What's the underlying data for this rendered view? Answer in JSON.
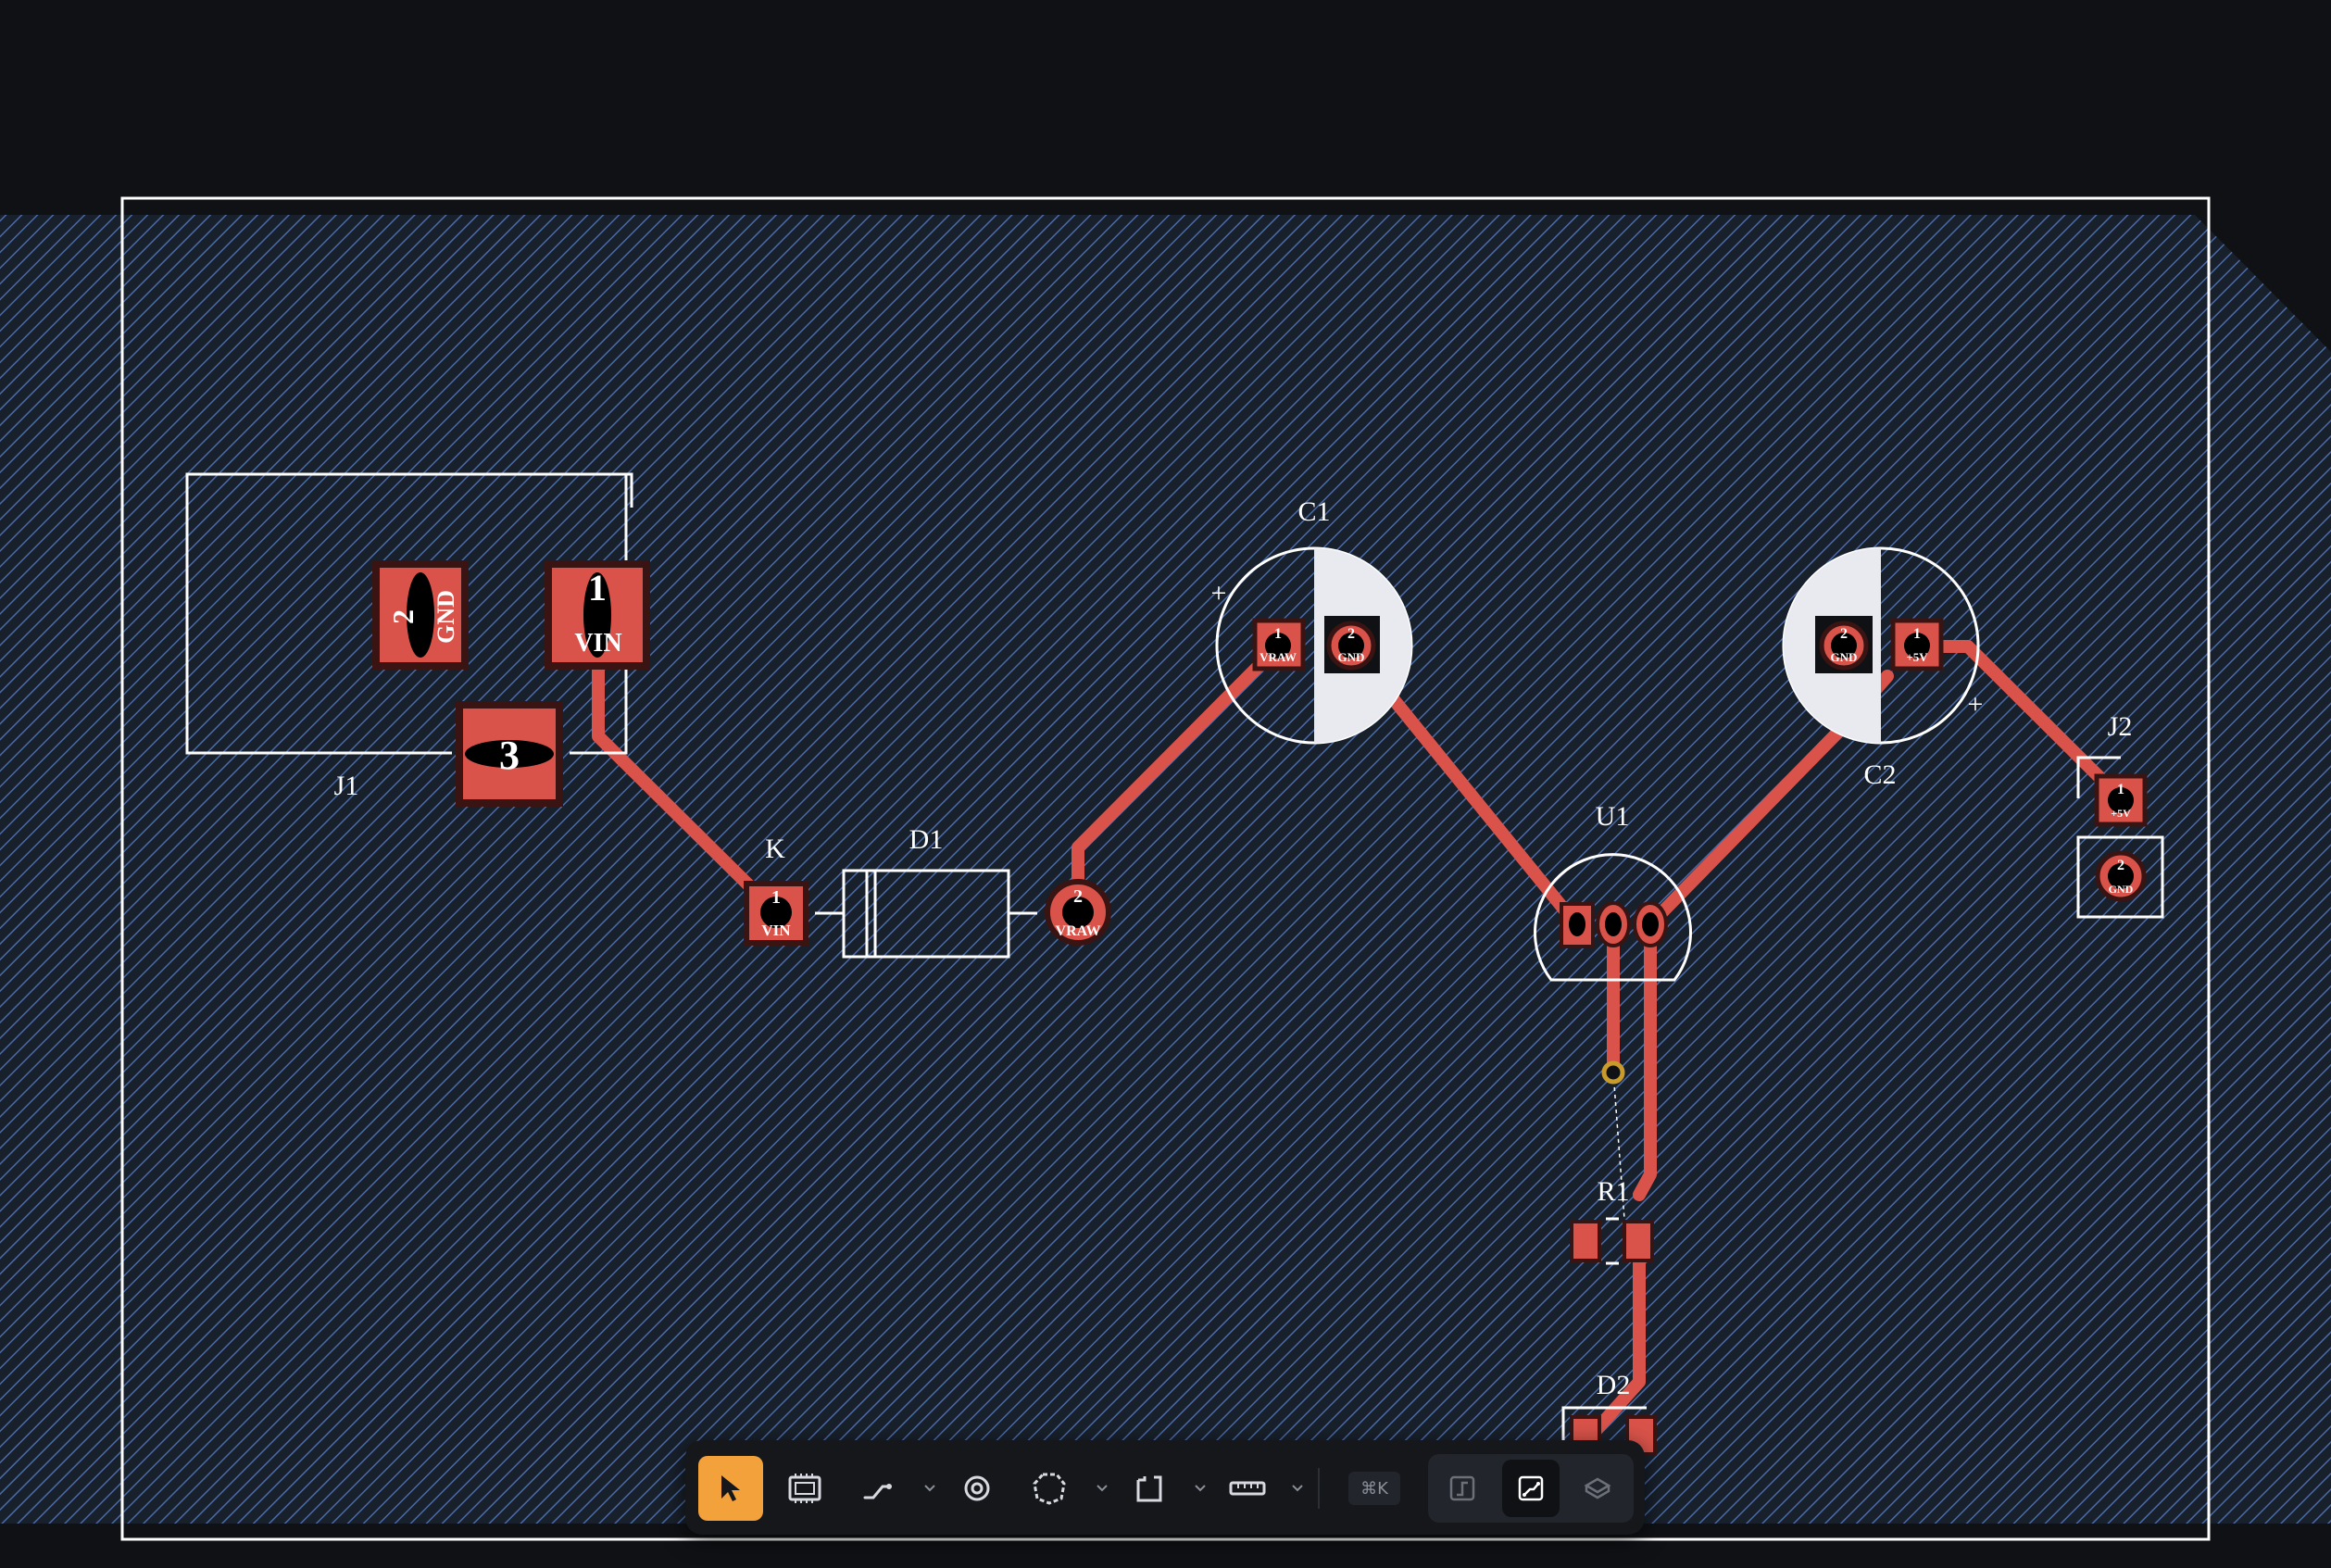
{
  "colors": {
    "background": "#0f1114",
    "board": "#18202b",
    "hatch": "#4a6aa8",
    "copper": "#d9534a",
    "silkscreen": "#ffffff",
    "via": "#c89b2a",
    "toolbar_bg": "#15171b",
    "toolbar_active": "#f2a13b"
  },
  "components": {
    "j1": {
      "ref": "J1",
      "pads": [
        {
          "num": "2",
          "net": "GND"
        },
        {
          "num": "1",
          "net": "VIN"
        },
        {
          "num": "3",
          "net": ""
        }
      ]
    },
    "k": {
      "ref": "K",
      "pad": {
        "num": "1",
        "net": "VIN"
      }
    },
    "d1": {
      "ref": "D1",
      "pad": {
        "num": "2",
        "net": "VRAW"
      }
    },
    "c1": {
      "ref": "C1",
      "plus": "+",
      "pads": [
        {
          "num": "1",
          "net": "VRAW"
        },
        {
          "num": "2",
          "net": "GND"
        }
      ]
    },
    "c2": {
      "ref": "C2",
      "plus": "+",
      "pads": [
        {
          "num": "2",
          "net": "GND"
        },
        {
          "num": "1",
          "net": "+5V"
        }
      ]
    },
    "j2": {
      "ref": "J2",
      "pads": [
        {
          "num": "1",
          "net": "+5V"
        },
        {
          "num": "2",
          "net": "GND"
        }
      ]
    },
    "u1": {
      "ref": "U1"
    },
    "r1": {
      "ref": "R1"
    },
    "d2": {
      "ref": "D2"
    }
  },
  "toolbar": {
    "tools": [
      {
        "name": "select",
        "icon": "cursor-icon",
        "active": true
      },
      {
        "name": "place-component",
        "icon": "chip-icon"
      },
      {
        "name": "route-trace",
        "icon": "trace-icon",
        "dropdown": true
      },
      {
        "name": "place-via",
        "icon": "via-icon"
      },
      {
        "name": "draw-zone",
        "icon": "zone-icon",
        "dropdown": true
      },
      {
        "name": "board-outline",
        "icon": "outline-icon",
        "dropdown": true
      },
      {
        "name": "measure",
        "icon": "ruler-icon",
        "dropdown": true
      }
    ],
    "shortcut": "⌘K",
    "views": [
      {
        "name": "schematic",
        "icon": "schematic-view-icon"
      },
      {
        "name": "pcb",
        "icon": "pcb-view-icon",
        "selected": true
      },
      {
        "name": "3d",
        "icon": "3d-view-icon"
      }
    ]
  }
}
